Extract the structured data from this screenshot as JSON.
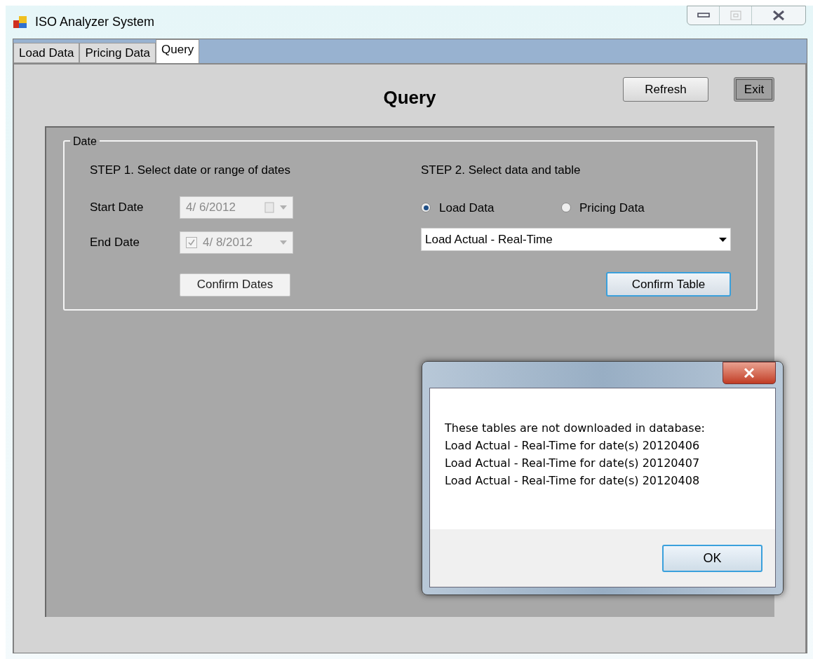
{
  "window": {
    "title": "ISO Analyzer System"
  },
  "tabs": [
    {
      "label": "Load Data",
      "selected": false
    },
    {
      "label": "Pricing Data",
      "selected": false
    },
    {
      "label": "Query",
      "selected": true
    }
  ],
  "heading": "Query",
  "buttons": {
    "refresh": "Refresh",
    "exit": "Exit"
  },
  "date_group": {
    "legend": "Date",
    "step1": {
      "label": "STEP 1. Select date or range of dates",
      "start_date": {
        "label": "Start Date",
        "value": "4/ 6/2012",
        "disabled": true
      },
      "end_date": {
        "label": "End Date",
        "value": "4/ 8/2012",
        "disabled": true,
        "checked": true
      },
      "confirm_button": "Confirm Dates"
    },
    "step2": {
      "label": "STEP 2. Select data and table",
      "radios": [
        {
          "label": "Load Data",
          "selected": true
        },
        {
          "label": "Pricing Data",
          "selected": false
        }
      ],
      "table_select": {
        "value": "Load Actual - Real-Time"
      },
      "confirm_button": "Confirm Table"
    }
  },
  "dialog": {
    "lines": [
      "These tables are not downloaded in database:",
      "Load Actual - Real-Time for date(s) 20120406",
      "Load Actual - Real-Time for date(s) 20120407",
      "Load Actual - Real-Time for date(s) 20120408"
    ],
    "ok_button": "OK"
  }
}
